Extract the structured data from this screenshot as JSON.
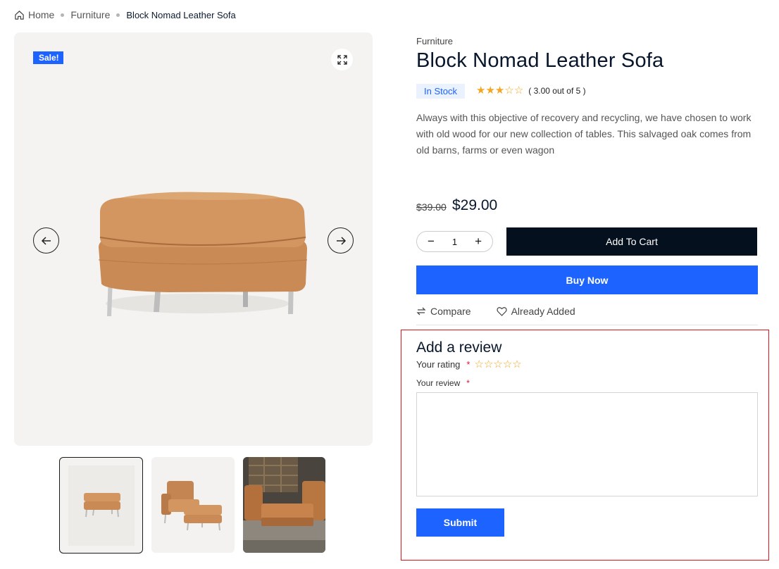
{
  "breadcrumb": {
    "home": "Home",
    "category": "Furniture",
    "current": "Block Nomad Leather Sofa"
  },
  "gallery": {
    "sale_badge": "Sale!",
    "zoom_icon": "expand-icon",
    "prev_icon": "arrow-left-icon",
    "next_icon": "arrow-right-icon",
    "thumbnails": [
      "ottoman",
      "chair-with-ottoman",
      "living-room"
    ]
  },
  "product": {
    "category": "Furniture",
    "title": "Block Nomad Leather Sofa",
    "stock": "In Stock",
    "rating_value": 3,
    "rating_max": 5,
    "rating_text": "( 3.00 out of 5 )",
    "description": "Always with this objective of recovery and recycling, we have chosen to work with old wood for our new collection of tables. This salvaged oak comes from old barns, farms or even wagon",
    "price_old": "$39.00",
    "price_new": "$29.00",
    "quantity": "1",
    "add_to_cart": "Add To Cart",
    "buy_now": "Buy Now",
    "compare": "Compare",
    "wishlist": "Already Added"
  },
  "review": {
    "title": "Add a review",
    "rating_label": "Your rating",
    "review_label": "Your review",
    "required_mark": "*",
    "textarea_value": "",
    "submit": "Submit"
  },
  "colors": {
    "accent": "#1d63ff",
    "dark": "#04101d",
    "star": "#f4a622",
    "highlight": "#e0141e"
  }
}
